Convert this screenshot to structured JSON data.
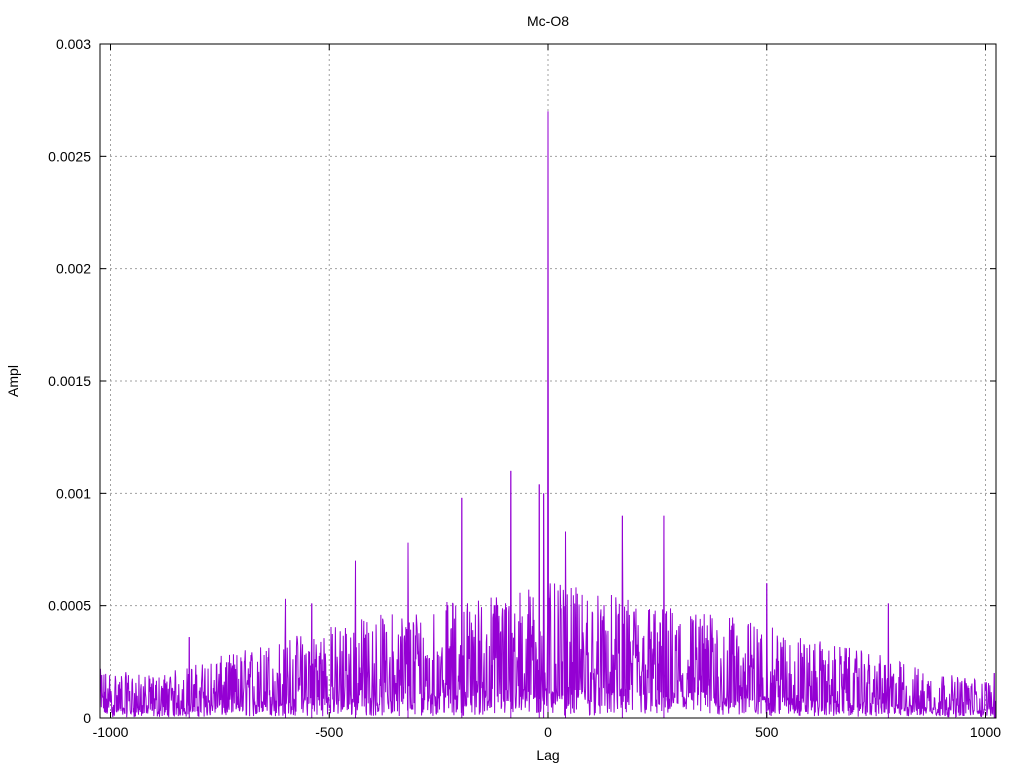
{
  "chart_data": {
    "type": "line",
    "title": "Mc-O8",
    "xlabel": "Lag",
    "ylabel": "Ampl",
    "xlim": [
      -1024,
      1024
    ],
    "ylim": [
      0,
      0.003
    ],
    "grid": true,
    "legend": "none",
    "color": "#9400d3",
    "x_ticks": [
      {
        "value": -1000,
        "label": "-1000"
      },
      {
        "value": -500,
        "label": "-500"
      },
      {
        "value": 0,
        "label": "0"
      },
      {
        "value": 500,
        "label": "500"
      },
      {
        "value": 1000,
        "label": "1000"
      }
    ],
    "y_ticks": [
      {
        "value": 0,
        "label": "0"
      },
      {
        "value": 0.0005,
        "label": "0.0005"
      },
      {
        "value": 0.001,
        "label": "0.001"
      },
      {
        "value": 0.0015,
        "label": "0.0015"
      },
      {
        "value": 0.002,
        "label": "0.002"
      },
      {
        "value": 0.0025,
        "label": "0.0025"
      },
      {
        "value": 0.003,
        "label": "0.003"
      }
    ],
    "peaks": [
      {
        "x": 0,
        "y": 0.0027
      },
      {
        "x": 0,
        "y": 0.00142
      },
      {
        "x": -85,
        "y": 0.0011
      },
      {
        "x": -20,
        "y": 0.00104
      },
      {
        "x": -10,
        "y": 0.001
      },
      {
        "x": -197,
        "y": 0.00098
      },
      {
        "x": 170,
        "y": 0.0009
      },
      {
        "x": 265,
        "y": 0.0009
      },
      {
        "x": 40,
        "y": 0.00083
      },
      {
        "x": -320,
        "y": 0.00078
      },
      {
        "x": -440,
        "y": 0.0007
      },
      {
        "x": 500,
        "y": 0.0006
      },
      {
        "x": -600,
        "y": 0.00053
      },
      {
        "x": -540,
        "y": 0.00051
      },
      {
        "x": 778,
        "y": 0.00051
      },
      {
        "x": -820,
        "y": 0.00036
      },
      {
        "x": 1020,
        "y": 0.0002
      }
    ],
    "envelope": [
      {
        "x": -1024,
        "y": 0.0002
      },
      {
        "x": -900,
        "y": 0.00017
      },
      {
        "x": -750,
        "y": 0.00025
      },
      {
        "x": -600,
        "y": 0.00033
      },
      {
        "x": -450,
        "y": 0.0004
      },
      {
        "x": -300,
        "y": 0.00045
      },
      {
        "x": -150,
        "y": 0.0005
      },
      {
        "x": 0,
        "y": 0.00055
      },
      {
        "x": 150,
        "y": 0.0005
      },
      {
        "x": 300,
        "y": 0.00045
      },
      {
        "x": 450,
        "y": 0.0004
      },
      {
        "x": 600,
        "y": 0.00032
      },
      {
        "x": 750,
        "y": 0.00026
      },
      {
        "x": 900,
        "y": 0.00018
      },
      {
        "x": 1024,
        "y": 0.00015
      }
    ]
  }
}
